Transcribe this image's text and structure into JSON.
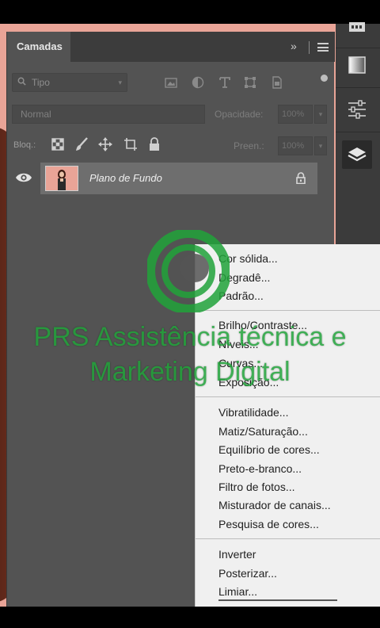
{
  "panel": {
    "tab_label": "Camadas",
    "collapse_glyph": "»",
    "filter": {
      "label": "Tipo",
      "chevron": "▾"
    },
    "blend_mode": "Normal",
    "opacity": {
      "label": "Opacidade:",
      "value": "100%",
      "arrow": "▾"
    },
    "lock": {
      "label": "Bloq.:"
    },
    "fill": {
      "label": "Preen.:",
      "value": "100%",
      "arrow": "▾"
    },
    "layers": [
      {
        "name": "Plano de Fundo",
        "visible": true,
        "locked": true
      }
    ]
  },
  "adjustment_menu": {
    "groups": [
      [
        "Cor sólida...",
        "Degradê...",
        "Padrão..."
      ],
      [
        "Brilho/Contraste...",
        "Níveis...",
        "Curvas...",
        "Exposição..."
      ],
      [
        "Vibratilidade...",
        "Matiz/Saturação...",
        "Equilíbrio de cores...",
        "Preto-e-branco...",
        "Filtro de fotos...",
        "Misturador de canais...",
        "Pesquisa de cores..."
      ],
      [
        "Inverter",
        "Posterizar...",
        "Limiar..."
      ]
    ]
  },
  "watermark": {
    "line1": "PRS Assistência técnica e",
    "line2": "Marketing Digital",
    "color": "#21a33a"
  },
  "dock": {
    "items": [
      "swatches-icon",
      "gradient-icon",
      "adjustments-sliders-icon",
      "layers-icon"
    ]
  },
  "colors": {
    "panel_bg": "#535353",
    "menu_bg": "#f0f0f0",
    "photo_bg": "#e9a497"
  }
}
